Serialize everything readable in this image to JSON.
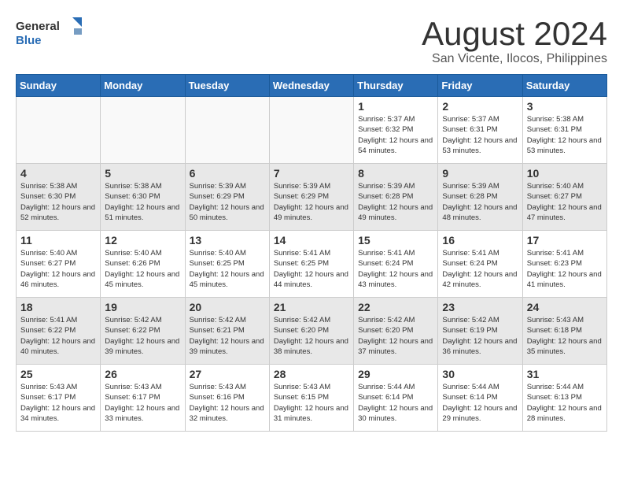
{
  "header": {
    "title": "August 2024",
    "subtitle": "San Vicente, Ilocos, Philippines",
    "logo_general": "General",
    "logo_blue": "Blue"
  },
  "weekdays": [
    "Sunday",
    "Monday",
    "Tuesday",
    "Wednesday",
    "Thursday",
    "Friday",
    "Saturday"
  ],
  "weeks": [
    [
      {
        "day": "",
        "empty": true
      },
      {
        "day": "",
        "empty": true
      },
      {
        "day": "",
        "empty": true
      },
      {
        "day": "",
        "empty": true
      },
      {
        "day": "1",
        "sunrise": "5:37 AM",
        "sunset": "6:32 PM",
        "daylight": "12 hours and 54 minutes."
      },
      {
        "day": "2",
        "sunrise": "5:37 AM",
        "sunset": "6:31 PM",
        "daylight": "12 hours and 53 minutes."
      },
      {
        "day": "3",
        "sunrise": "5:38 AM",
        "sunset": "6:31 PM",
        "daylight": "12 hours and 53 minutes."
      }
    ],
    [
      {
        "day": "4",
        "sunrise": "5:38 AM",
        "sunset": "6:30 PM",
        "daylight": "12 hours and 52 minutes."
      },
      {
        "day": "5",
        "sunrise": "5:38 AM",
        "sunset": "6:30 PM",
        "daylight": "12 hours and 51 minutes."
      },
      {
        "day": "6",
        "sunrise": "5:39 AM",
        "sunset": "6:29 PM",
        "daylight": "12 hours and 50 minutes."
      },
      {
        "day": "7",
        "sunrise": "5:39 AM",
        "sunset": "6:29 PM",
        "daylight": "12 hours and 49 minutes."
      },
      {
        "day": "8",
        "sunrise": "5:39 AM",
        "sunset": "6:28 PM",
        "daylight": "12 hours and 49 minutes."
      },
      {
        "day": "9",
        "sunrise": "5:39 AM",
        "sunset": "6:28 PM",
        "daylight": "12 hours and 48 minutes."
      },
      {
        "day": "10",
        "sunrise": "5:40 AM",
        "sunset": "6:27 PM",
        "daylight": "12 hours and 47 minutes."
      }
    ],
    [
      {
        "day": "11",
        "sunrise": "5:40 AM",
        "sunset": "6:27 PM",
        "daylight": "12 hours and 46 minutes."
      },
      {
        "day": "12",
        "sunrise": "5:40 AM",
        "sunset": "6:26 PM",
        "daylight": "12 hours and 45 minutes."
      },
      {
        "day": "13",
        "sunrise": "5:40 AM",
        "sunset": "6:25 PM",
        "daylight": "12 hours and 45 minutes."
      },
      {
        "day": "14",
        "sunrise": "5:41 AM",
        "sunset": "6:25 PM",
        "daylight": "12 hours and 44 minutes."
      },
      {
        "day": "15",
        "sunrise": "5:41 AM",
        "sunset": "6:24 PM",
        "daylight": "12 hours and 43 minutes."
      },
      {
        "day": "16",
        "sunrise": "5:41 AM",
        "sunset": "6:24 PM",
        "daylight": "12 hours and 42 minutes."
      },
      {
        "day": "17",
        "sunrise": "5:41 AM",
        "sunset": "6:23 PM",
        "daylight": "12 hours and 41 minutes."
      }
    ],
    [
      {
        "day": "18",
        "sunrise": "5:41 AM",
        "sunset": "6:22 PM",
        "daylight": "12 hours and 40 minutes."
      },
      {
        "day": "19",
        "sunrise": "5:42 AM",
        "sunset": "6:22 PM",
        "daylight": "12 hours and 39 minutes."
      },
      {
        "day": "20",
        "sunrise": "5:42 AM",
        "sunset": "6:21 PM",
        "daylight": "12 hours and 39 minutes."
      },
      {
        "day": "21",
        "sunrise": "5:42 AM",
        "sunset": "6:20 PM",
        "daylight": "12 hours and 38 minutes."
      },
      {
        "day": "22",
        "sunrise": "5:42 AM",
        "sunset": "6:20 PM",
        "daylight": "12 hours and 37 minutes."
      },
      {
        "day": "23",
        "sunrise": "5:42 AM",
        "sunset": "6:19 PM",
        "daylight": "12 hours and 36 minutes."
      },
      {
        "day": "24",
        "sunrise": "5:43 AM",
        "sunset": "6:18 PM",
        "daylight": "12 hours and 35 minutes."
      }
    ],
    [
      {
        "day": "25",
        "sunrise": "5:43 AM",
        "sunset": "6:17 PM",
        "daylight": "12 hours and 34 minutes."
      },
      {
        "day": "26",
        "sunrise": "5:43 AM",
        "sunset": "6:17 PM",
        "daylight": "12 hours and 33 minutes."
      },
      {
        "day": "27",
        "sunrise": "5:43 AM",
        "sunset": "6:16 PM",
        "daylight": "12 hours and 32 minutes."
      },
      {
        "day": "28",
        "sunrise": "5:43 AM",
        "sunset": "6:15 PM",
        "daylight": "12 hours and 31 minutes."
      },
      {
        "day": "29",
        "sunrise": "5:44 AM",
        "sunset": "6:14 PM",
        "daylight": "12 hours and 30 minutes."
      },
      {
        "day": "30",
        "sunrise": "5:44 AM",
        "sunset": "6:14 PM",
        "daylight": "12 hours and 29 minutes."
      },
      {
        "day": "31",
        "sunrise": "5:44 AM",
        "sunset": "6:13 PM",
        "daylight": "12 hours and 28 minutes."
      }
    ]
  ]
}
